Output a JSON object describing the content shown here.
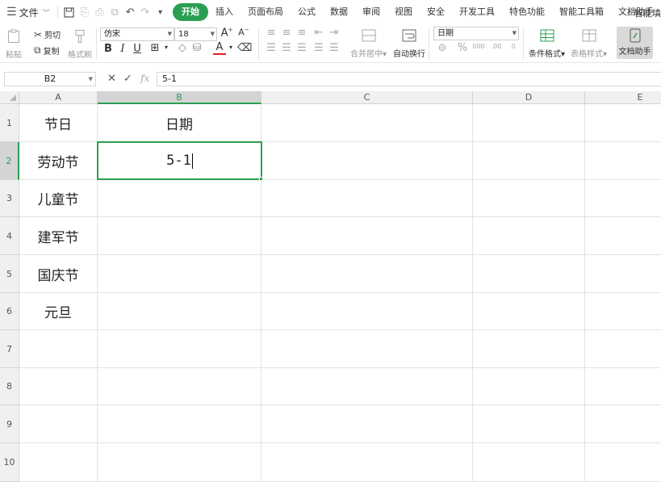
{
  "menu": {
    "file_label": "文件",
    "tabs": [
      "开始",
      "插入",
      "页面布局",
      "公式",
      "数据",
      "审阅",
      "视图",
      "安全",
      "开发工具",
      "特色功能",
      "智能工具箱",
      "文档助手"
    ],
    "active_tab": "开始",
    "search_label": "智能填"
  },
  "ribbon": {
    "paste": "粘贴",
    "cut": "剪切",
    "copy": "复制",
    "format_painter": "格式刷",
    "font_name": "仿宋",
    "font_size": "18",
    "merge_center": "合并居中",
    "wrap_text": "自动换行",
    "number_format": "日期",
    "cond_format": "条件格式",
    "table_style": "表格样式",
    "doc_assistant": "文档助手"
  },
  "formula_bar": {
    "name_box": "B2",
    "fx_label": "fx",
    "formula": "5-1"
  },
  "columns": [
    "A",
    "B",
    "C",
    "D",
    "E"
  ],
  "selected_column": "B",
  "rows": [
    "1",
    "2",
    "3",
    "4",
    "5",
    "6",
    "7",
    "8",
    "9",
    "10"
  ],
  "selected_row": "2",
  "cells": {
    "A1": "节日",
    "B1": "日期",
    "A2": "劳动节",
    "B2": "5-1",
    "A3": "儿童节",
    "A4": "建军节",
    "A5": "国庆节",
    "A6": "元旦"
  },
  "colors": {
    "accent": "#2a9f52",
    "header_bg": "#f0f0f0",
    "selected_header_bg": "#d4d4d4",
    "gridline": "#e2e2e2"
  },
  "icons": {
    "menu": "hamburger-icon",
    "save": "save-icon",
    "undo": "undo-icon",
    "redo": "redo-icon",
    "cancel": "cancel-icon",
    "confirm": "check-icon",
    "search": "search-icon"
  }
}
